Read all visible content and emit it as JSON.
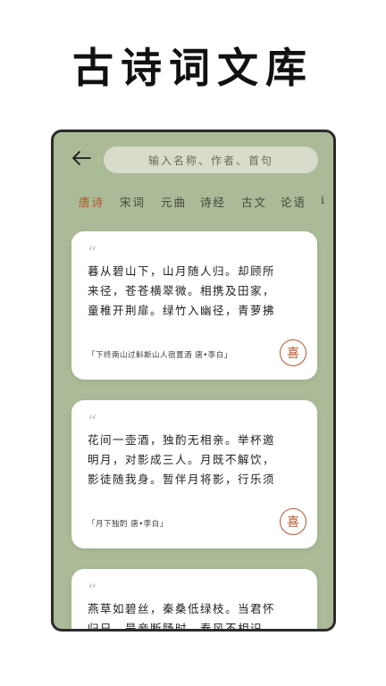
{
  "headline": "古诗词文库",
  "search": {
    "placeholder": "输入名称、作者、首句"
  },
  "tabs": [
    {
      "label": "唐诗",
      "active": true
    },
    {
      "label": "宋词",
      "active": false
    },
    {
      "label": "元曲",
      "active": false
    },
    {
      "label": "诗经",
      "active": false
    },
    {
      "label": "古文",
      "active": false
    },
    {
      "label": "论语",
      "active": false
    },
    {
      "label": "i",
      "active": false
    }
  ],
  "cards": [
    {
      "lines": [
        "暮从碧山下，山月随人归。却顾所",
        "来径，苍苍横翠微。相携及田家，",
        "童稚开荆扉。绿竹入幽径，青萝拂"
      ],
      "source": "「下终南山过斛斯山人宿置酒  唐•李白」",
      "fav_label": "喜"
    },
    {
      "lines": [
        "花间一壶酒，独酌无相亲。举杯邀",
        "明月，对影成三人。月既不解饮，",
        "影徒随我身。暂伴月将影，行乐须"
      ],
      "source": "「月下独酌  唐•李白」",
      "fav_label": "喜"
    },
    {
      "lines": [
        "燕草如碧丝，秦桑低绿枝。当君怀",
        "归日，是妾断肠时。春风不相识，"
      ],
      "source": "",
      "fav_label": ""
    }
  ],
  "colors": {
    "accent": "#b6552c",
    "phone_bg": "#abba97",
    "search_bg": "#d8dccb"
  }
}
